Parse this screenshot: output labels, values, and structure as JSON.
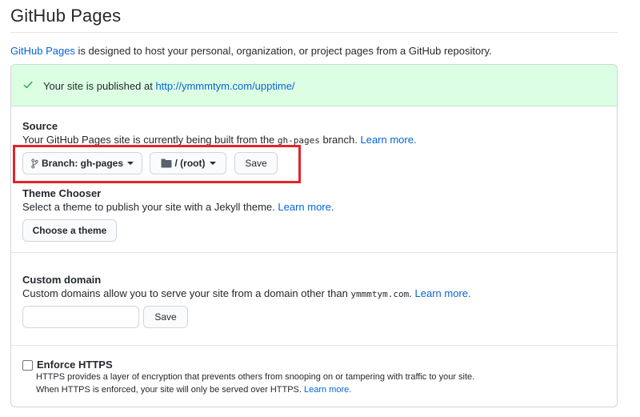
{
  "page": {
    "title": "GitHub Pages",
    "intro_link": "GitHub Pages",
    "intro_rest": " is designed to host your personal, organization, or project pages from a GitHub repository."
  },
  "flash": {
    "icon": "check-icon",
    "text": "Your site is published at ",
    "url": "http://ymmmtym.com/upptime/"
  },
  "source": {
    "heading": "Source",
    "desc_before": "Your GitHub Pages site is currently being built from the ",
    "branch_code": "gh-pages",
    "desc_after": " branch. ",
    "learn_more": "Learn more.",
    "branch_button": "Branch: gh-pages",
    "folder_button": "/ (root)",
    "save_button": "Save"
  },
  "theme": {
    "heading": "Theme Chooser",
    "desc": "Select a theme to publish your site with a Jekyll theme. ",
    "learn_more": "Learn more.",
    "button": "Choose a theme"
  },
  "custom_domain": {
    "heading": "Custom domain",
    "desc_before": "Custom domains allow you to serve your site from a domain other than ",
    "domain_code": "ymmmtym.com",
    "desc_after": ". ",
    "learn_more": "Learn more.",
    "input_value": "",
    "input_placeholder": "",
    "save_button": "Save"
  },
  "https": {
    "label": "Enforce HTTPS",
    "checked": false,
    "line1": "HTTPS provides a layer of encryption that prevents others from snooping on or tampering with traffic to your site.",
    "line2": "When HTTPS is enforced, your site will only be served over HTTPS. ",
    "learn_more": "Learn more."
  },
  "colors": {
    "link": "#0366d6",
    "success_bg": "#dcffe4",
    "highlight": "#e3242b"
  }
}
